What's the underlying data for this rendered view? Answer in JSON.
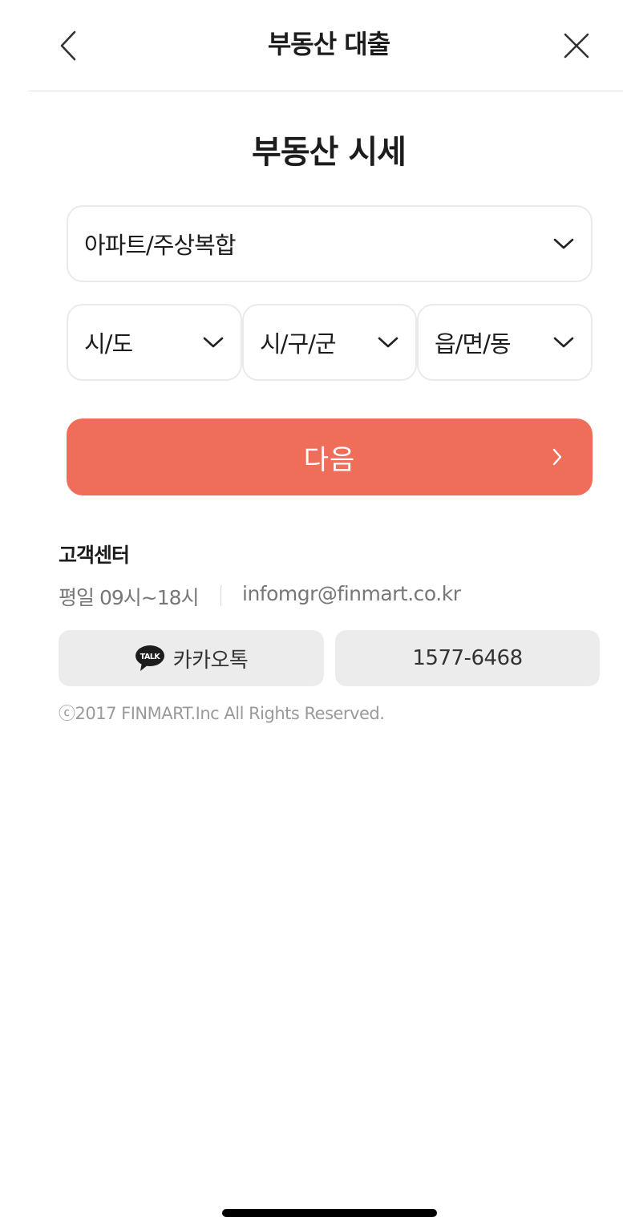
{
  "header": {
    "title": "부동산 대출",
    "back_icon": "chevron-left-icon",
    "close_icon": "close-icon"
  },
  "page": {
    "title": "부동산 시세"
  },
  "form": {
    "property_type": {
      "value": "아파트/주상복합",
      "icon": "chevron-down-icon"
    },
    "sido": {
      "value": "시/도",
      "icon": "chevron-down-icon"
    },
    "sigungu": {
      "value": "시/구/군",
      "icon": "chevron-down-icon"
    },
    "dong": {
      "value": "읍/면/동",
      "icon": "chevron-down-icon"
    },
    "next_button": {
      "label": "다음",
      "icon": "chevron-right-icon",
      "color": "#ee6e5a"
    }
  },
  "customer_center": {
    "title": "고객센터",
    "hours": "평일 09시~18시",
    "email": "infomgr@finmart.co.kr",
    "kakao_button": {
      "label": "카카오톡",
      "icon": "kakaotalk-icon"
    },
    "phone_button": {
      "label": "1577-6468"
    },
    "copyright": "ⓒ2017 FINMART.Inc All Rights Reserved."
  }
}
